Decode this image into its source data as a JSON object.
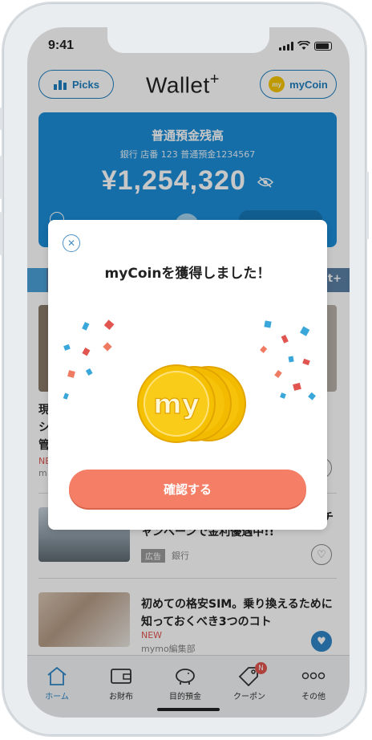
{
  "status": {
    "time": "9:41"
  },
  "header": {
    "picks_label": "Picks",
    "logo_text": "Wallet",
    "logo_sup": "+",
    "mycoin_label": "myCoin",
    "mycoin_badge": "my"
  },
  "balance": {
    "title": "普通預金残高",
    "account": "銀行 店番 123 普通預金1234567",
    "amount": "¥1,254,320"
  },
  "strip": {
    "right_text": "t+"
  },
  "modal": {
    "title": "myCoinを獲得しました！",
    "coin_text": "my",
    "confirm_label": "確認する"
  },
  "news": [
    {
      "title_lines": [
        "現",
        "シ",
        "管"
      ],
      "badge": "NEW",
      "source": "m"
    },
    {
      "title": "ャンペーンで金利優遇中!!",
      "title_tail": "チ",
      "tag": "広告",
      "source": "銀行"
    },
    {
      "title": "初めての格安SIM。乗り換えるために知っておくべき3つのコト",
      "badge": "NEW",
      "source": "mymo編集部"
    }
  ],
  "bottom_nav": [
    {
      "label": "ホーム",
      "icon": "home-icon"
    },
    {
      "label": "お財布",
      "icon": "wallet-icon"
    },
    {
      "label": "目的預金",
      "icon": "piggy-bank-icon"
    },
    {
      "label": "クーポン",
      "icon": "coupon-icon",
      "badge": "N"
    },
    {
      "label": "その他",
      "icon": "more-icon"
    }
  ],
  "colors": {
    "accent": "#1c8ed8",
    "confirm": "#f57f66",
    "coin": "#f5c400"
  }
}
